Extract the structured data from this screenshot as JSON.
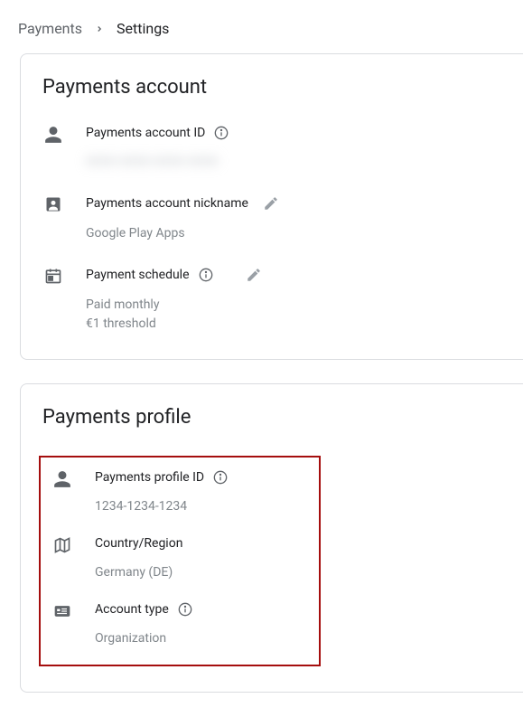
{
  "breadcrumb": {
    "parent": "Payments",
    "current": "Settings"
  },
  "account": {
    "title": "Payments account",
    "id_label": "Payments account ID",
    "id_value": "0000-0000-0000-0000",
    "nickname_label": "Payments account nickname",
    "nickname_value": "Google Play Apps",
    "schedule_label": "Payment schedule",
    "schedule_line1": "Paid monthly",
    "schedule_line2": "€1 threshold"
  },
  "profile": {
    "title": "Payments profile",
    "id_label": "Payments profile ID",
    "id_value": "1234-1234-1234",
    "country_label": "Country/Region",
    "country_value": "Germany (DE)",
    "type_label": "Account type",
    "type_value": "Organization"
  },
  "icons": {
    "person": "person-icon",
    "badge": "badge-icon",
    "calendar": "calendar-icon",
    "map": "map-icon",
    "card": "card-icon",
    "info": "info-icon",
    "edit": "edit-icon",
    "chevron": "chevron-right-icon"
  }
}
